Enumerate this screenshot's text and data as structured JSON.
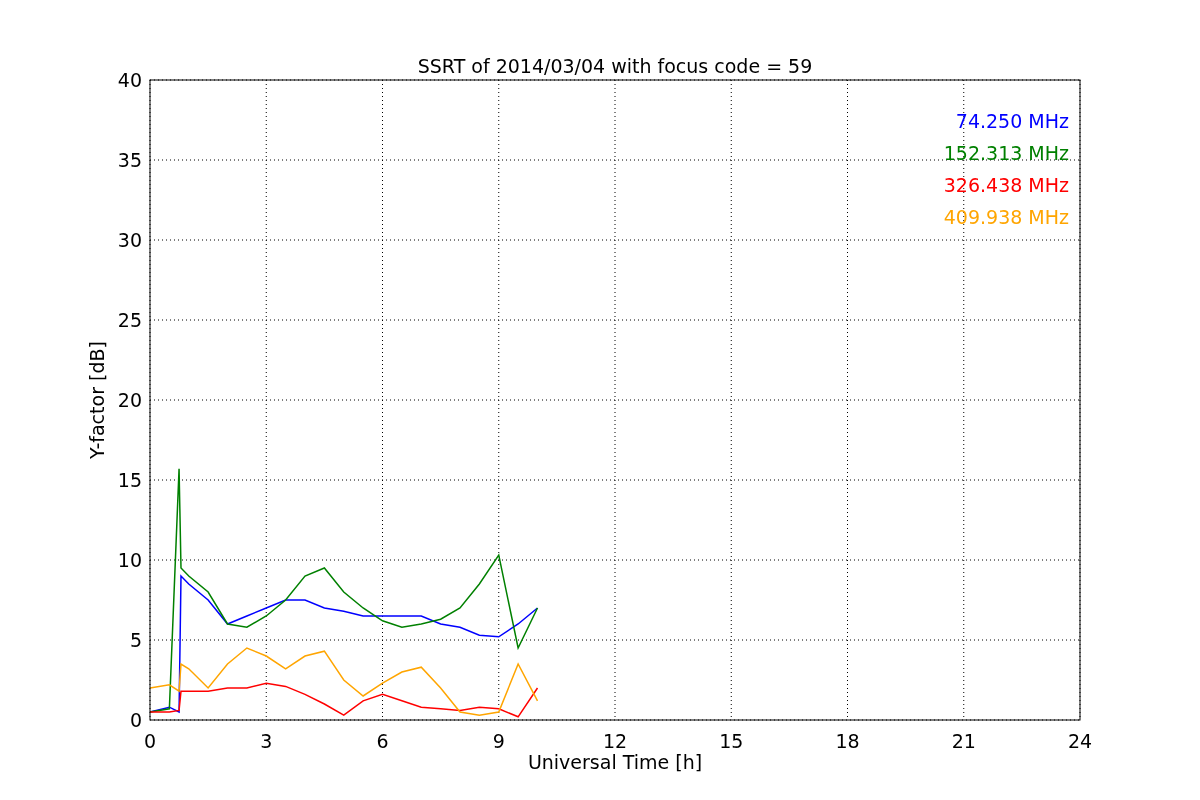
{
  "chart_data": {
    "type": "line",
    "title": "SSRT of 2014/03/04 with focus code = 59",
    "xlabel": "Universal Time [h]",
    "ylabel": "Y-factor [dB]",
    "xlim": [
      0,
      24
    ],
    "ylim": [
      0,
      40
    ],
    "xticks": [
      0,
      3,
      6,
      9,
      12,
      15,
      18,
      21,
      24
    ],
    "yticks": [
      0,
      5,
      10,
      15,
      20,
      25,
      30,
      35,
      40
    ],
    "grid": true,
    "x": [
      0,
      0.5,
      0.75,
      0.8,
      1,
      1.5,
      2,
      2.5,
      3,
      3.5,
      4,
      4.5,
      5,
      5.5,
      6,
      6.5,
      7,
      7.5,
      8,
      8.5,
      9,
      9.5,
      10
    ],
    "series": [
      {
        "name": "74.250 MHz",
        "color": "#0000ff",
        "values": [
          0.5,
          0.8,
          0.5,
          9,
          8.5,
          7.5,
          6,
          6.5,
          7,
          7.5,
          7.5,
          7,
          6.8,
          6.5,
          6.5,
          6.5,
          6.5,
          6,
          5.8,
          5.3,
          5.2,
          6,
          7
        ]
      },
      {
        "name": "152.313 MHz",
        "color": "#008000",
        "values": [
          0.5,
          0.7,
          15.7,
          9.5,
          9,
          8,
          6,
          5.8,
          6.5,
          7.5,
          9,
          9.5,
          8,
          7,
          6.2,
          5.8,
          6,
          6.3,
          7,
          8.5,
          10.3,
          4.5,
          7
        ]
      },
      {
        "name": "326.438 MHz",
        "color": "#ff0000",
        "values": [
          0.5,
          0.5,
          0.6,
          1.8,
          1.8,
          1.8,
          2,
          2,
          2.3,
          2.1,
          1.6,
          1,
          0.3,
          1.2,
          1.6,
          1.2,
          0.8,
          0.7,
          0.6,
          0.8,
          0.7,
          0.2,
          2
        ]
      },
      {
        "name": "409.938 MHz",
        "color": "#ffa500",
        "values": [
          2,
          2.2,
          1.8,
          3.5,
          3.2,
          2,
          3.5,
          4.5,
          4,
          3.2,
          4,
          4.3,
          2.5,
          1.5,
          2.3,
          3,
          3.3,
          2,
          0.5,
          0.3,
          0.5,
          3.5,
          1.2
        ]
      }
    ]
  }
}
